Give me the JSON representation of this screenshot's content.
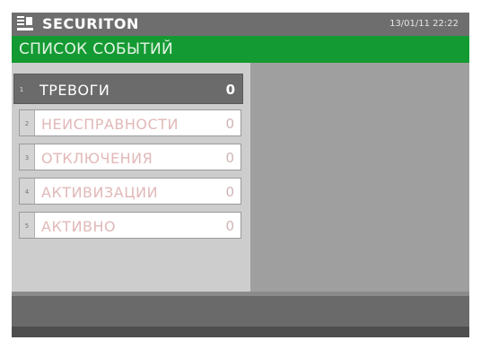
{
  "header": {
    "brand": "SECURITON",
    "datetime": "13/01/11 22:22",
    "logo_icon": "panel-logo-icon"
  },
  "title": "СПИСОК СОБЫТИЙ",
  "colors": {
    "title_bar": "#149a32",
    "top_bar": "#6e6e6e",
    "active_row": "#6b6b6b"
  },
  "events": [
    {
      "index": "1",
      "label": "ТРЕВОГИ",
      "count": "0",
      "selected": true
    },
    {
      "index": "2",
      "label": "НЕИСПРАВНОСТИ",
      "count": "0",
      "selected": false
    },
    {
      "index": "3",
      "label": "ОТКЛЮЧЕНИЯ",
      "count": "0",
      "selected": false
    },
    {
      "index": "4",
      "label": "АКТИВИЗАЦИИ",
      "count": "0",
      "selected": false
    },
    {
      "index": "5",
      "label": "АКТИВНО",
      "count": "0",
      "selected": false
    }
  ]
}
